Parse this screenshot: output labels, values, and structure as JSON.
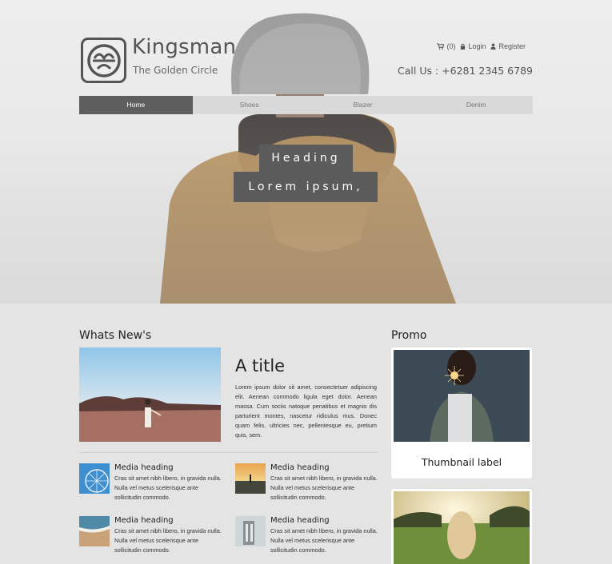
{
  "brand": {
    "title": "Kingsman",
    "subtitle": "The Golden Circle"
  },
  "topbar": {
    "cart": "(0)",
    "login": "Login",
    "register": "Register"
  },
  "phone": "Call Us : +6281 2345 6789",
  "nav": {
    "tabs": [
      {
        "label": "Home"
      },
      {
        "label": "Shoes"
      },
      {
        "label": "Blazer"
      },
      {
        "label": "Denim"
      }
    ]
  },
  "hero": {
    "heading": "Heading",
    "subheading": "Lorem ipsum,"
  },
  "whatsnew": {
    "title": "Whats New's",
    "feature": {
      "title": "A title",
      "text": "Lorem ipsum dolor sit amet, consectetuer adipiscing elit. Aenean commodo ligula eget dolor. Aenean massa. Cum sociis natoque penatibus et magnis dis parturient montes, nascetur ridiculus mus. Donec quam felis, ultricies nec, pellentesque eu, pretium quis, sem."
    },
    "media": [
      {
        "heading": "Media heading",
        "text": "Cras sit amet nibh libero, in gravida nulla. Nulla vel metus scelerisque ante sollicitudin commodo."
      },
      {
        "heading": "Media heading",
        "text": "Cras sit amet nibh libero, in gravida nulla. Nulla vel metus scelerisque ante sollicitudin commodo."
      },
      {
        "heading": "Media heading",
        "text": "Cras sit amet nibh libero, in gravida nulla. Nulla vel metus scelerisque ante sollicitudin commodo."
      },
      {
        "heading": "Media heading",
        "text": "Cras sit amet nibh libero, in gravida nulla. Nulla vel metus scelerisque ante sollicitudin commodo."
      }
    ]
  },
  "promo": {
    "title": "Promo",
    "cards": [
      {
        "label": "Thumbnail label"
      },
      {
        "label": ""
      }
    ]
  },
  "colors": {
    "nav_active": "#5e5e5e",
    "nav_bg": "#d9d9d9",
    "page_bg": "#e4e4e4",
    "heading_box": "#5b5b5b"
  },
  "icons": {
    "cart": "shopping-cart-icon",
    "login": "lock-icon",
    "register": "user-icon"
  }
}
